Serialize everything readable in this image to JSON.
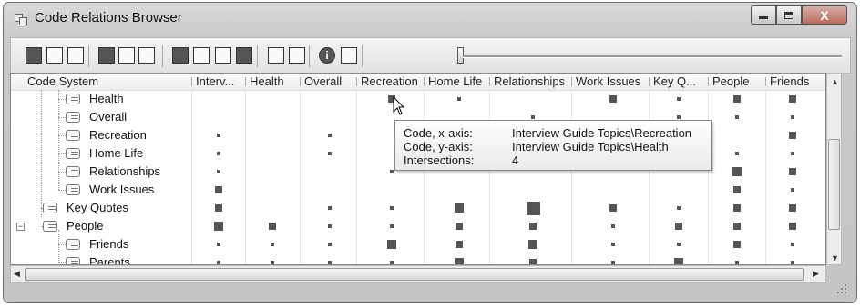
{
  "window": {
    "title": "Code Relations Browser"
  },
  "window_buttons": {
    "minimize": "–",
    "maximize": "□",
    "close": "X"
  },
  "toolbar": {
    "icons": [
      "export-icon",
      "save-icon",
      "print-icon",
      "layout-a-icon",
      "layout-b-icon",
      "layout-c-icon",
      "number-display-icon",
      "symbol-display-icon",
      "transpose-icon",
      "copy-icon",
      "list-icon",
      "refresh-icon",
      "info-icon",
      "run-icon"
    ],
    "info_glyph": "i"
  },
  "columns": [
    "Code System",
    "Interv...",
    "Health",
    "Overall",
    "Recreation",
    "Home Life",
    "Relationships",
    "Work Issues",
    "Key Q...",
    "People",
    "Friends"
  ],
  "rows": [
    {
      "label": "Health",
      "level": 2
    },
    {
      "label": "Overall",
      "level": 2
    },
    {
      "label": "Recreation",
      "level": 2
    },
    {
      "label": "Home Life",
      "level": 2
    },
    {
      "label": "Relationships",
      "level": 2
    },
    {
      "label": "Work Issues",
      "level": 2
    },
    {
      "label": "Key Quotes",
      "level": 1
    },
    {
      "label": "People",
      "level": 1,
      "expander": "−"
    },
    {
      "label": "Friends",
      "level": 2
    },
    {
      "label": "Parents",
      "level": 2
    }
  ],
  "matrix": [
    [
      0,
      0,
      0,
      0,
      2,
      1,
      0,
      2,
      1,
      2,
      2
    ],
    [
      0,
      0,
      0,
      0,
      0,
      0,
      1,
      0,
      1,
      1,
      1
    ],
    [
      0,
      1,
      0,
      1,
      0,
      1,
      0,
      1,
      0,
      0,
      2
    ],
    [
      0,
      1,
      0,
      1,
      0,
      0,
      0,
      0,
      0,
      1,
      1
    ],
    [
      0,
      1,
      0,
      0,
      1,
      0,
      0,
      0,
      0,
      3,
      2
    ],
    [
      0,
      2,
      0,
      0,
      0,
      0,
      0,
      0,
      0,
      2,
      1
    ],
    [
      0,
      2,
      0,
      1,
      1,
      3,
      4,
      2,
      1,
      2,
      2
    ],
    [
      0,
      3,
      2,
      1,
      1,
      2,
      2,
      1,
      2,
      2,
      2
    ],
    [
      0,
      1,
      1,
      1,
      3,
      2,
      3,
      1,
      1,
      2,
      1
    ],
    [
      0,
      1,
      1,
      1,
      1,
      3,
      2,
      1,
      3,
      1,
      1
    ]
  ],
  "tooltip": {
    "x_label": "Code, x-axis:",
    "x_value": "Interview Guide Topics\\Recreation",
    "y_label": "Code, y-axis:",
    "y_value": "Interview Guide Topics\\Health",
    "i_label": "Intersections:",
    "i_value": "4"
  },
  "scrollbar": {
    "up": "▲",
    "down": "▼",
    "left": "◀",
    "right": "▶"
  }
}
